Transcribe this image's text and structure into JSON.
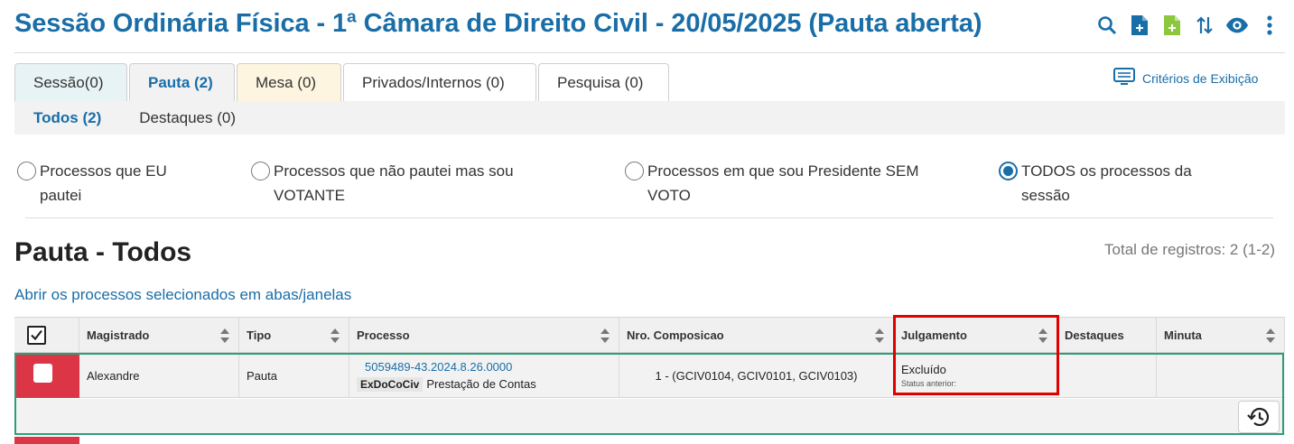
{
  "header": {
    "title": "Sessão Ordinária Física - 1ª Câmara de Direito Civil - 20/05/2025 (Pauta aberta)",
    "icons": [
      "search-icon",
      "file-add-icon",
      "file-add-icon",
      "sort-arrows-icon",
      "eye-icon",
      "more-vertical-icon"
    ],
    "accent": "#1a6ea8"
  },
  "tabs": [
    {
      "label": "Sessão(0)"
    },
    {
      "label": "Pauta (2)"
    },
    {
      "label": "Mesa (0)"
    },
    {
      "label": "Privados/Internos (0)"
    },
    {
      "label": "Pesquisa (0)"
    }
  ],
  "criterios_label": "Critérios de Exibição",
  "subtabs": [
    {
      "label": "Todos (2)"
    },
    {
      "label": "Destaques (0)"
    }
  ],
  "filters": [
    {
      "line1": "Processos que EU",
      "line2": "pautei",
      "selected": false
    },
    {
      "line1": "Processos que não pautei mas sou",
      "line2": "VOTANTE",
      "selected": false
    },
    {
      "line1": "Processos em que sou Presidente SEM",
      "line2": "VOTO",
      "selected": false
    },
    {
      "line1": "TODOS os processos da",
      "line2": "sessão",
      "selected": true
    }
  ],
  "section_title": "Pauta - Todos",
  "total_label": "Total de registros: 2 (1-2)",
  "open_selected_link": "Abrir os processos selecionados em abas/janelas",
  "table": {
    "columns": [
      "Magistrado",
      "Tipo",
      "Processo",
      "Nro. Composicao",
      "Julgamento",
      "Destaques",
      "Minuta"
    ],
    "rows": [
      {
        "magistrado": "Alexandre",
        "tipo": "Pauta",
        "processo_numero": "5059489-43.2024.8.26.0000",
        "classe": "ExDoCoCiv",
        "assunto": "Prestação de Contas",
        "composicao": "1 - (GCIV0104, GCIV0101, GCIV0103)",
        "julgamento": "Excluído",
        "status_anterior": "Status anterior:",
        "destaques": "",
        "minuta": ""
      }
    ]
  },
  "colors": {
    "row_marker": "#dc3545",
    "selected_frame": "#2e9e79",
    "highlight_box": "#e00000"
  }
}
